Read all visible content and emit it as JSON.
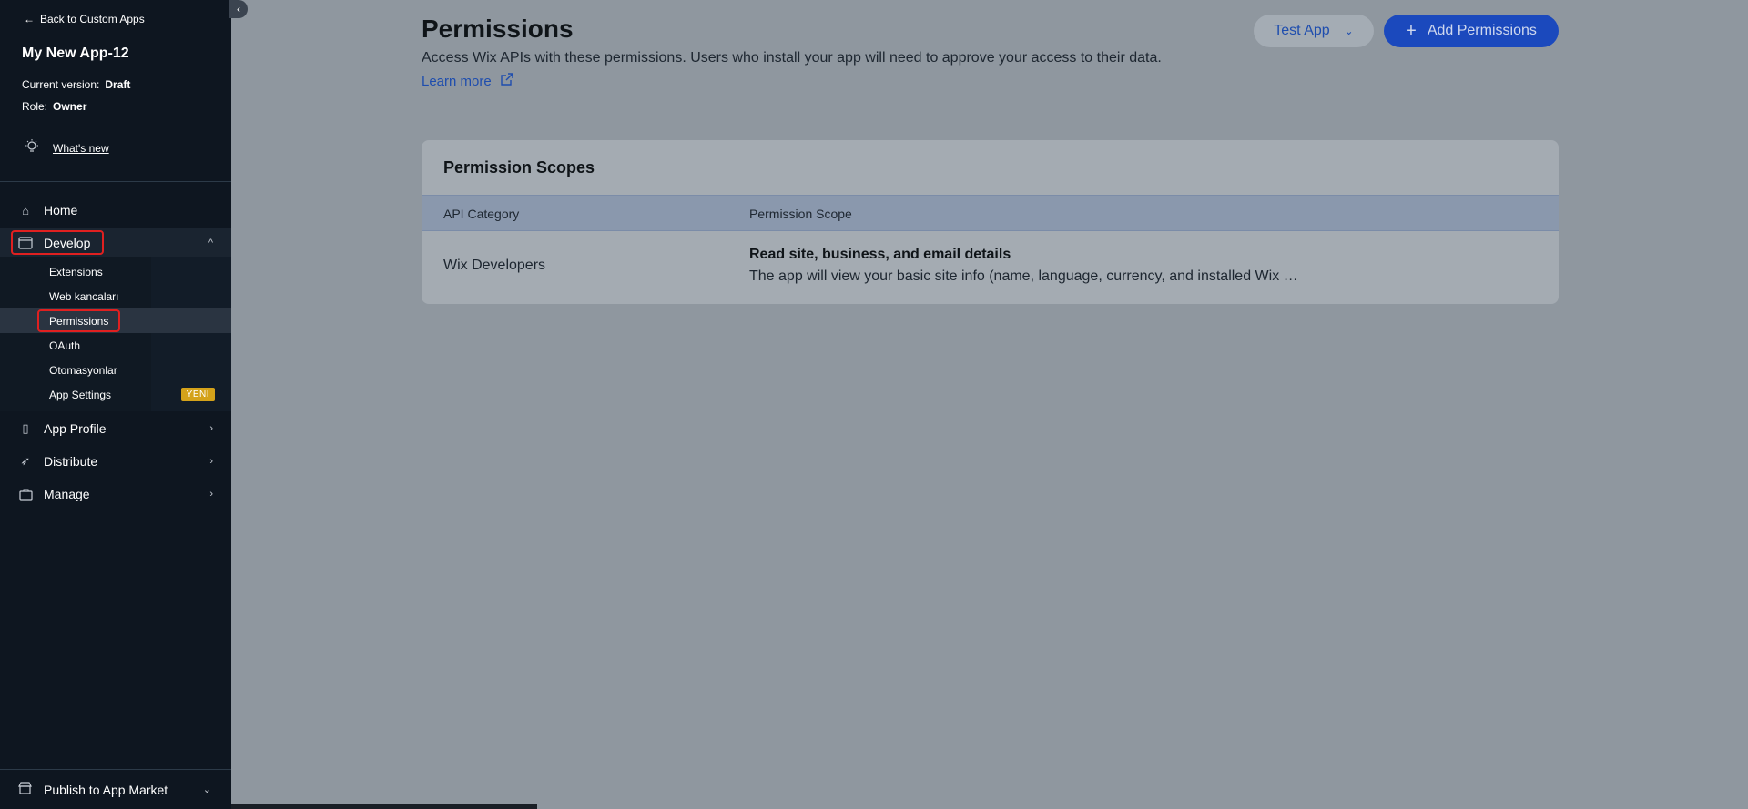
{
  "sidebar": {
    "back_label": "Back to Custom Apps",
    "app_name": "My New App-12",
    "version_label": "Current version:",
    "version_value": "Draft",
    "role_label": "Role:",
    "role_value": "Owner",
    "whats_new": "What's new",
    "nav": {
      "home": "Home",
      "develop": "Develop",
      "app_profile": "App Profile",
      "distribute": "Distribute",
      "manage": "Manage"
    },
    "sub_items": {
      "extensions": "Extensions",
      "web_kancalari": "Web kancaları",
      "permissions": "Permissions",
      "oauth": "OAuth",
      "otomasyonlar": "Otomasyonlar",
      "app_settings": "App Settings"
    },
    "new_badge": "YENİ",
    "publish": "Publish to App Market"
  },
  "header": {
    "title": "Permissions",
    "description": "Access Wix APIs with these permissions. Users who install your app will need to approve your access to their data.",
    "learn_more": "Learn more",
    "test_app": "Test App",
    "add_permissions": "Add Permissions"
  },
  "card": {
    "title": "Permission Scopes",
    "columns": [
      "API Category",
      "Permission Scope"
    ],
    "rows": [
      {
        "category": "Wix Developers",
        "scope_title": "Read site, business, and email details",
        "scope_desc": "The app will view your basic site info (name, language, currency, and installed Wix …"
      }
    ]
  },
  "colors": {
    "accent": "#1b49bd",
    "highlight_border": "#e02020",
    "badge": "#d4a21a"
  }
}
